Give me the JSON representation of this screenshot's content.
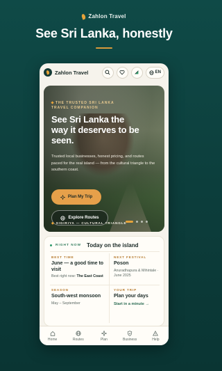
{
  "promo": {
    "brand": "Zahlon Travel",
    "headline": "See Sri Lanka, honestly"
  },
  "app": {
    "name": "Zahlon Travel",
    "language": "EN"
  },
  "hero": {
    "eyebrow": "THE TRUSTED SRI LANKA TRAVEL COMPANION",
    "title": "See Sri Lanka the way it deserves to be seen.",
    "body": "Trusted local businesses, honest pricing, and routes paced for the real island — from the cultural triangle to the southern coast.",
    "primary_button": "Plan My Trip",
    "secondary_button": "Explore Routes",
    "caption_place": "SIGIRIYA",
    "caption_region": "CULTURAL TRIANGLE",
    "slides_total": 4,
    "slide_active": 1
  },
  "right_now": {
    "tag": "RIGHT NOW",
    "title": "Today on the island",
    "best_time": {
      "label": "BEST TIME",
      "value": "June — a good time to visit",
      "sub_prefix": "Best right now:",
      "sub_value": "The East Coast"
    },
    "next_festival": {
      "label": "NEXT FESTIVAL",
      "value": "Poson",
      "sub": "Anuradhapura & Mihintale · June 2025"
    },
    "season": {
      "label": "SEASON",
      "value": "South-west monsoon",
      "sub": "May – September"
    },
    "your_trip": {
      "label": "YOUR TRIP",
      "value": "Plan your days",
      "link": "Start in a minute →"
    }
  },
  "nav": {
    "items": [
      {
        "label": "Home",
        "icon": "home-icon"
      },
      {
        "label": "Routes",
        "icon": "globe-icon"
      },
      {
        "label": "Plan",
        "icon": "compass-icon"
      },
      {
        "label": "Business",
        "icon": "shield-icon"
      },
      {
        "label": "Help",
        "icon": "alert-icon"
      }
    ]
  },
  "colors": {
    "background": "#0f4a47",
    "accent": "#e6a04a",
    "card": "#fffdf8",
    "text_dark": "#1b2b28"
  }
}
